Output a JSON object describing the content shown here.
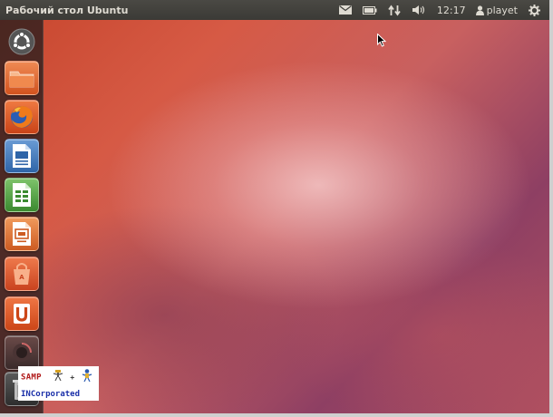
{
  "panel": {
    "window_title": "Рабочий стол Ubuntu",
    "clock": "12:17",
    "user": "playet",
    "icons": [
      "mail-icon",
      "battery-icon",
      "network-icon",
      "volume-icon",
      "user-icon",
      "power-gear-icon"
    ]
  },
  "launcher": {
    "items": [
      {
        "name": "dash-home-icon"
      },
      {
        "name": "home-folder-icon"
      },
      {
        "name": "firefox-icon"
      },
      {
        "name": "libreoffice-writer-icon"
      },
      {
        "name": "libreoffice-calc-icon"
      },
      {
        "name": "libreoffice-impress-icon"
      },
      {
        "name": "software-center-icon"
      },
      {
        "name": "ubuntu-one-icon"
      },
      {
        "name": "dark-app-icon"
      },
      {
        "name": "trash-icon"
      }
    ]
  },
  "watermark": {
    "line1": "SAMP",
    "line2": "INCorporated",
    "plus": "+"
  },
  "colors": {
    "panel_bg": "#3c3b37",
    "ubuntu_orange": "#dd4814",
    "desktop_aubergine": "#8e3f63"
  }
}
